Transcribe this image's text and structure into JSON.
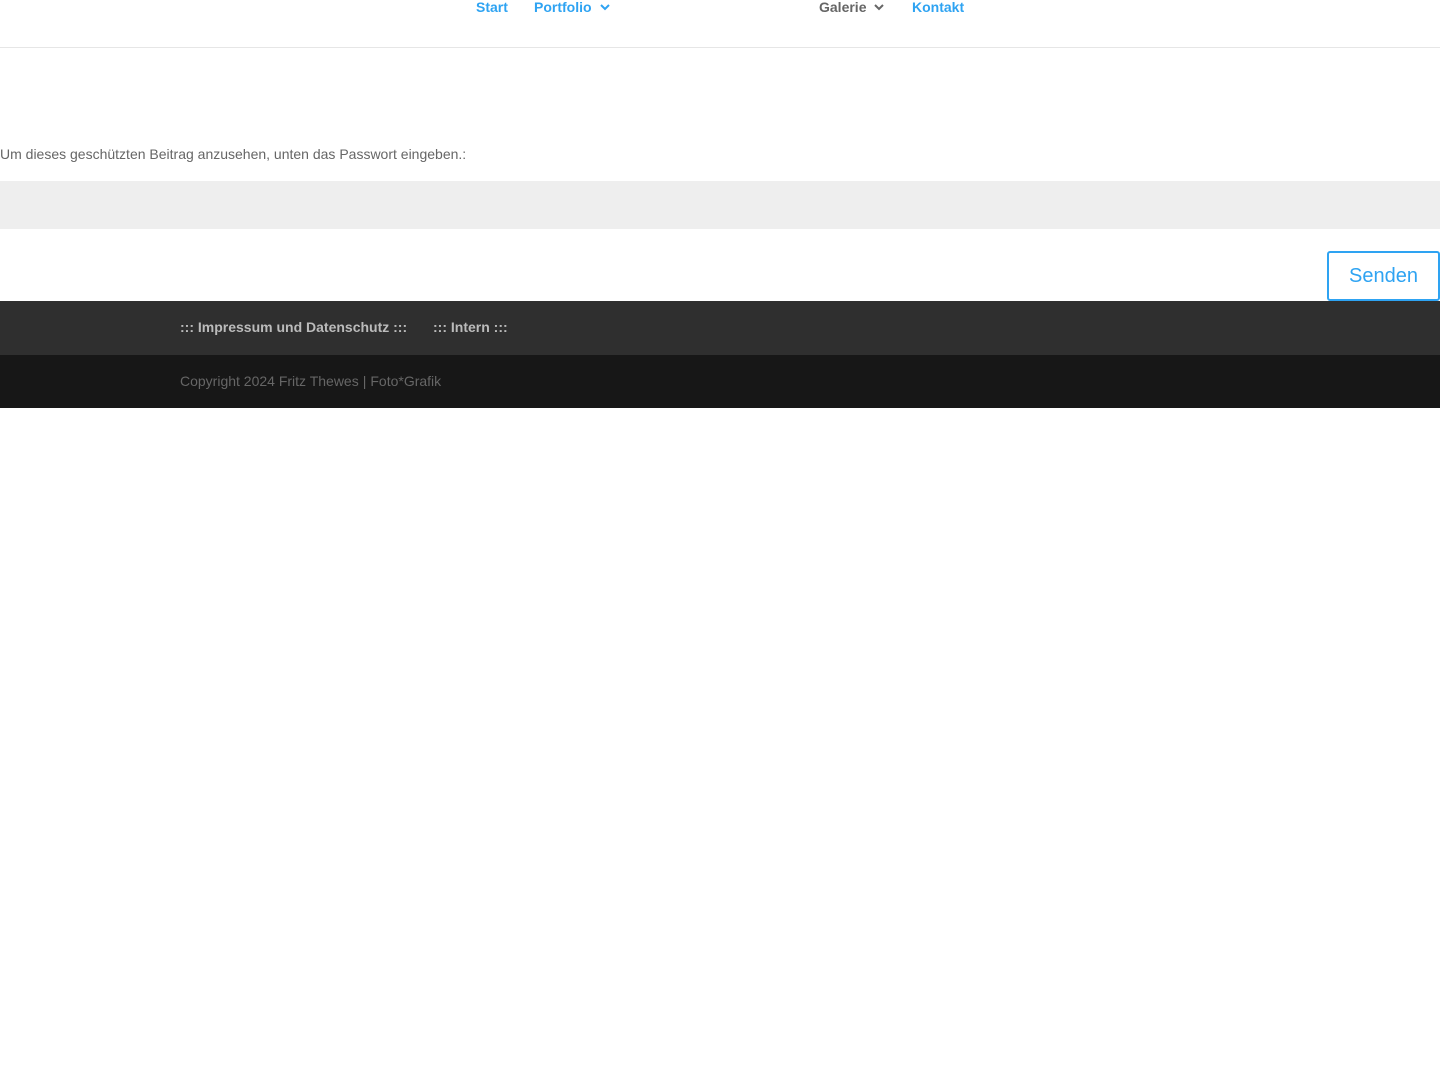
{
  "nav": {
    "items": [
      {
        "label": "Start",
        "has_submenu": false
      },
      {
        "label": "Portfolio",
        "has_submenu": true
      },
      {
        "label": "Galerie",
        "has_submenu": true
      },
      {
        "label": "Kontakt",
        "has_submenu": false
      }
    ],
    "active_color": "#2ea3f2",
    "inactive_color": "#666666"
  },
  "form": {
    "prompt": "Um dieses geschützten Beitrag anzusehen, unten das Passwort eingeben.:",
    "password_value": "",
    "submit_label": "Senden"
  },
  "footer": {
    "links": [
      {
        "label": "::: Impressum und Datenschutz :::"
      },
      {
        "label": "::: Intern :::"
      }
    ],
    "copyright": "Copyright 2024 Fritz Thewes",
    "separator": "|",
    "brand": "Foto*Grafik"
  },
  "colors": {
    "accent": "#2ea3f2",
    "input_bg": "#eeeeee",
    "footer_top": "#2f2f2f",
    "footer_bottom": "#171717"
  }
}
